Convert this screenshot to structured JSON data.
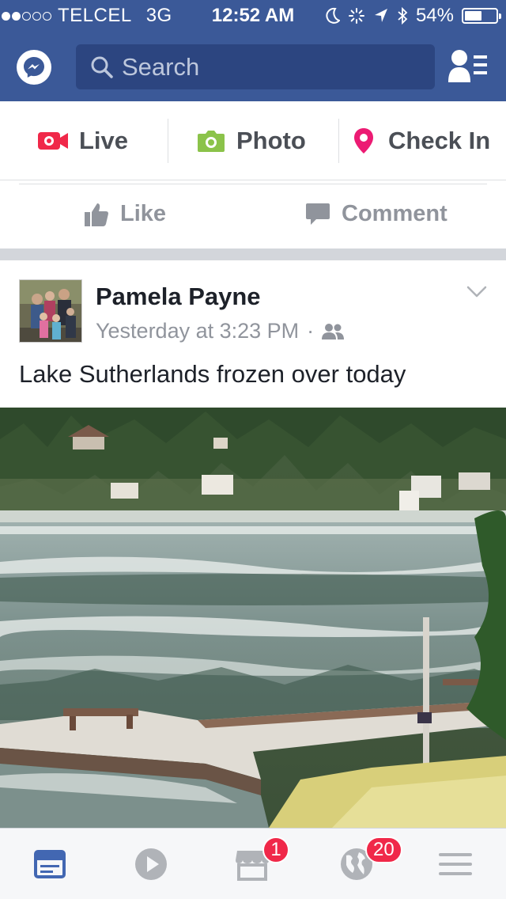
{
  "status_bar": {
    "carrier": "TELCEL",
    "network": "3G",
    "time": "12:52 AM",
    "battery": "54%",
    "battery_level": 0.54,
    "signal_bars": 2
  },
  "header": {
    "search_placeholder": "Search",
    "icons": [
      "messenger-icon",
      "search-icon",
      "friend-requests-icon"
    ],
    "brand_color": "#3b5998"
  },
  "composer": {
    "live_label": "Live",
    "photo_label": "Photo",
    "checkin_label": "Check In",
    "live_color": "#f02849",
    "photo_color": "#8bc34a",
    "checkin_color": "#ec1b73"
  },
  "actions": {
    "like_label": "Like",
    "comment_label": "Comment"
  },
  "post": {
    "author": "Pamela Payne",
    "timestamp": "Yesterday at 3:23 PM",
    "separator": "·",
    "audience_icon": "friends-icon",
    "text": "Lake Sutherlands frozen over today"
  },
  "tabbar": {
    "tabs": [
      {
        "name": "news-feed-icon",
        "active": true
      },
      {
        "name": "video-icon",
        "active": false
      },
      {
        "name": "marketplace-icon",
        "active": false,
        "badge": "1"
      },
      {
        "name": "notifications-globe-icon",
        "active": false,
        "badge": "20"
      },
      {
        "name": "menu-icon",
        "active": false
      }
    ]
  }
}
